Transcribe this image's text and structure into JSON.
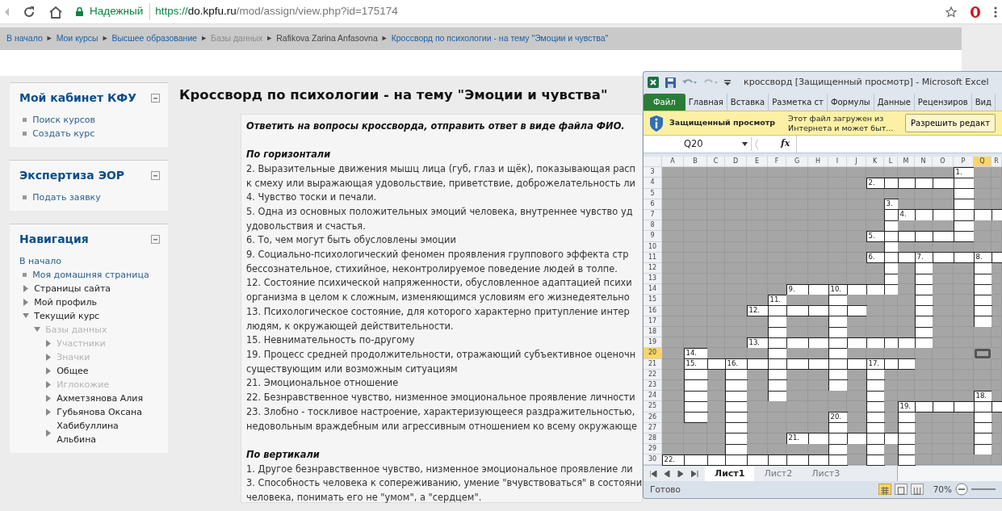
{
  "browser": {
    "security": "Надежный",
    "url_scheme": "https://",
    "url_host": "do.kpfu.ru",
    "url_path": "/mod/assign/view.php?id=175174"
  },
  "breadcrumb": {
    "separator": "►",
    "items": [
      {
        "text": "В начало",
        "kind": "link"
      },
      {
        "text": "Мои курсы",
        "kind": "link"
      },
      {
        "text": "Высшее образование",
        "kind": "link"
      },
      {
        "text": "Базы данных",
        "kind": "dimmed"
      },
      {
        "text": "Rafikova Zarina Anfasovna",
        "kind": "plain"
      },
      {
        "text": "Кроссворд по психологии - на тему \"Эмоции и чувства\"",
        "kind": "link"
      }
    ]
  },
  "sidebar": [
    {
      "title": "Мой кабинет КФУ",
      "items": [
        {
          "kind": "bullet",
          "text": "Поиск курсов"
        },
        {
          "kind": "bullet",
          "text": "Создать курс"
        }
      ]
    },
    {
      "title": "Экспертиза ЭОР",
      "items": [
        {
          "kind": "bullet",
          "text": "Подать заявку"
        }
      ]
    },
    {
      "title": "Навигация",
      "items": [
        {
          "kind": "link",
          "text": "В начало"
        },
        {
          "kind": "bullet",
          "text": "Моя домашняя страница"
        },
        {
          "kind": "node",
          "text": "Страницы сайта",
          "expanded": false,
          "disabled": false
        },
        {
          "kind": "node",
          "text": "Мой профиль",
          "expanded": false,
          "disabled": false
        },
        {
          "kind": "node",
          "text": "Текущий курс",
          "expanded": true,
          "disabled": false,
          "children": [
            {
              "kind": "node",
              "text": "Базы данных",
              "expanded": true,
              "disabled": true,
              "children": [
                {
                  "kind": "node",
                  "text": "Участники",
                  "expanded": false,
                  "disabled": true
                },
                {
                  "kind": "node",
                  "text": "Значки",
                  "expanded": false,
                  "disabled": true
                },
                {
                  "kind": "node",
                  "text": "Общее",
                  "expanded": false,
                  "disabled": false
                },
                {
                  "kind": "node",
                  "text": "Иглокожие",
                  "expanded": false,
                  "disabled": true
                },
                {
                  "kind": "node",
                  "text": "Ахметзянова Алия",
                  "expanded": false,
                  "disabled": false
                },
                {
                  "kind": "node",
                  "text": "Губьянова Оксана",
                  "expanded": false,
                  "disabled": false
                },
                {
                  "kind": "node",
                  "text": "Хабибуллина Альбина",
                  "expanded": false,
                  "disabled": false
                }
              ]
            }
          ]
        }
      ]
    }
  ],
  "page_title": "Кроссворд по психологии - на тему \"Эмоции и чувства\"",
  "assignment": {
    "intro": "Ответить на вопросы кроссворда, отправить ответ в виде файла ФИО.",
    "sections": [
      {
        "heading": "По горизонтали",
        "lines": [
          "2. Выразительные движения мышц лица (губ, глаз и щёк), показывающая расп",
          "к смеху или выражающая удовольствие, приветствие, доброжелательность ли",
          "4. Чувство тоски и печали.",
          "5. Одна из основных положительных эмоций человека, внутреннее чувство уд",
          "удовольствия и счастья.",
          "6. То, чем могут быть обусловлены эмоции",
          "9. Социально-психологический феномен проявления группового эффекта стр",
          "бессознательное, стихийное, неконтролируемое поведение людей в толпе.",
          "12. Состояние психической напряженности, обусловленное адаптацией психи",
          "организма в целом к сложным, изменяющимся условиям его жизнедеятельно",
          "13. Психологическое состояние, для которого характерно притупление интер",
          "людям, к окружающей действительности.",
          "15. Невнимательность по-другому",
          "19. Процесс средней продолжительности, отражающий субъективное оценочн",
          "существующим или возможным ситуациям",
          "21. Эмоциональное отношение",
          "22. Безнравственное чувство, низменное эмоциональное проявление личности",
          "23. Злобно - тоскливое настроение, характеризующееся раздражительностью,",
          "недовольным враждебным или агрессивным отношением ко всему окружающе"
        ]
      },
      {
        "heading": "По вертикали",
        "lines": [
          "1. Другое безнравственное чувство, низменное эмоциональное проявление ли",
          "3. Способность человека к сопереживанию, умение \"вчувствоваться\" в состояни",
          "человека, понимать его не \"умом\", а \"сердцем\"."
        ]
      }
    ]
  },
  "excel": {
    "title": "кроссворд [Защищенный просмотр] - Microsoft Excel",
    "ribbon_tabs": [
      {
        "label": "Файл",
        "kind": "file"
      },
      {
        "label": "Главная",
        "kind": "tab"
      },
      {
        "label": "Вставка",
        "kind": "tab"
      },
      {
        "label": "Разметка ст",
        "kind": "tab"
      },
      {
        "label": "Формулы",
        "kind": "tab"
      },
      {
        "label": "Данные",
        "kind": "tab"
      },
      {
        "label": "Рецензиров",
        "kind": "tab"
      },
      {
        "label": "Вид",
        "kind": "tab"
      }
    ],
    "protected_view": {
      "title": "Защищенный просмотр",
      "message_lines": [
        "Этот файл загружен из",
        "Интернета и может быт..."
      ],
      "button": "Разрешить редакт"
    },
    "name_box": "Q20",
    "function_symbol": "fx",
    "columns": [
      {
        "label": "A",
        "selected": false
      },
      {
        "label": "B",
        "selected": false
      },
      {
        "label": "C",
        "selected": false
      },
      {
        "label": "D",
        "selected": false
      },
      {
        "label": "E",
        "selected": false
      },
      {
        "label": "F",
        "selected": false
      },
      {
        "label": "G",
        "selected": false
      },
      {
        "label": "H",
        "selected": false
      },
      {
        "label": "I",
        "selected": false
      },
      {
        "label": "J",
        "selected": false
      },
      {
        "label": "K",
        "selected": false
      },
      {
        "label": "L",
        "selected": false
      },
      {
        "label": "M",
        "selected": false
      },
      {
        "label": "N",
        "selected": false
      },
      {
        "label": "O",
        "selected": false
      },
      {
        "label": "P",
        "selected": false
      },
      {
        "label": "Q",
        "selected": true
      },
      {
        "label": "R",
        "selected": false
      }
    ],
    "rows": [
      {
        "header": "3",
        "selected": false,
        "cells": [
          false,
          false,
          false,
          false,
          false,
          false,
          false,
          false,
          false,
          false,
          false,
          false,
          false,
          false,
          false,
          "1.",
          false,
          false
        ]
      },
      {
        "header": "4",
        "selected": false,
        "cells": [
          false,
          false,
          false,
          false,
          false,
          false,
          false,
          false,
          false,
          false,
          "2.",
          true,
          true,
          true,
          true,
          true,
          false,
          false
        ]
      },
      {
        "header": "5",
        "selected": false,
        "cells": [
          false,
          false,
          false,
          false,
          false,
          false,
          false,
          false,
          false,
          false,
          false,
          false,
          false,
          false,
          false,
          true,
          false,
          false
        ]
      },
      {
        "header": "6",
        "selected": false,
        "cells": [
          false,
          false,
          false,
          false,
          false,
          false,
          false,
          false,
          false,
          false,
          false,
          "3.",
          false,
          false,
          false,
          true,
          false,
          false
        ]
      },
      {
        "header": "7",
        "selected": false,
        "cells": [
          false,
          false,
          false,
          false,
          false,
          false,
          false,
          false,
          false,
          false,
          false,
          true,
          "4.",
          true,
          true,
          true,
          true,
          true
        ]
      },
      {
        "header": "8",
        "selected": false,
        "cells": [
          false,
          false,
          false,
          false,
          false,
          false,
          false,
          false,
          false,
          false,
          false,
          true,
          false,
          false,
          false,
          true,
          false,
          false
        ]
      },
      {
        "header": "9",
        "selected": false,
        "cells": [
          false,
          false,
          false,
          false,
          false,
          false,
          false,
          false,
          false,
          false,
          "5.",
          true,
          true,
          true,
          true,
          true,
          false,
          false
        ]
      },
      {
        "header": "10",
        "selected": false,
        "cells": [
          false,
          false,
          false,
          false,
          false,
          false,
          false,
          false,
          false,
          false,
          false,
          true,
          false,
          false,
          false,
          false,
          false,
          false
        ]
      },
      {
        "header": "11",
        "selected": false,
        "cells": [
          false,
          false,
          false,
          false,
          false,
          false,
          false,
          false,
          false,
          false,
          "6.",
          true,
          true,
          "7.",
          true,
          true,
          "8.",
          true
        ]
      },
      {
        "header": "12",
        "selected": false,
        "cells": [
          false,
          false,
          false,
          false,
          false,
          false,
          false,
          false,
          false,
          false,
          false,
          true,
          false,
          true,
          false,
          false,
          true,
          false
        ]
      },
      {
        "header": "13",
        "selected": false,
        "cells": [
          false,
          false,
          false,
          false,
          false,
          false,
          false,
          false,
          false,
          false,
          false,
          true,
          false,
          true,
          false,
          false,
          true,
          false
        ]
      },
      {
        "header": "14",
        "selected": false,
        "cells": [
          false,
          false,
          false,
          false,
          false,
          false,
          "9.",
          true,
          "10.",
          true,
          true,
          true,
          false,
          true,
          false,
          false,
          true,
          false
        ]
      },
      {
        "header": "15",
        "selected": false,
        "cells": [
          false,
          false,
          false,
          false,
          false,
          "11.",
          false,
          false,
          true,
          false,
          false,
          false,
          false,
          true,
          false,
          false,
          true,
          false
        ]
      },
      {
        "header": "16",
        "selected": false,
        "cells": [
          false,
          false,
          false,
          false,
          "12.",
          true,
          true,
          true,
          true,
          true,
          false,
          false,
          false,
          true,
          false,
          false,
          true,
          false
        ]
      },
      {
        "header": "17",
        "selected": false,
        "cells": [
          false,
          false,
          false,
          false,
          false,
          true,
          false,
          false,
          true,
          false,
          false,
          false,
          false,
          true,
          false,
          false,
          true,
          false
        ]
      },
      {
        "header": "18",
        "selected": false,
        "cells": [
          false,
          false,
          false,
          false,
          false,
          true,
          false,
          false,
          true,
          false,
          false,
          false,
          false,
          true,
          false,
          false,
          false,
          false
        ]
      },
      {
        "header": "19",
        "selected": false,
        "cells": [
          false,
          false,
          false,
          false,
          "13.",
          true,
          true,
          true,
          true,
          true,
          true,
          true,
          true,
          true,
          false,
          false,
          false,
          false
        ]
      },
      {
        "header": "20",
        "selected": true,
        "cells": [
          false,
          "14.",
          false,
          false,
          false,
          true,
          false,
          false,
          true,
          false,
          false,
          false,
          false,
          false,
          false,
          false,
          false,
          false
        ]
      },
      {
        "header": "21",
        "selected": false,
        "cells": [
          false,
          "15.",
          true,
          "16.",
          true,
          true,
          true,
          true,
          true,
          true,
          "17.",
          true,
          true,
          false,
          false,
          false,
          false,
          false
        ]
      },
      {
        "header": "22",
        "selected": false,
        "cells": [
          false,
          true,
          false,
          true,
          false,
          true,
          false,
          false,
          true,
          false,
          true,
          false,
          false,
          false,
          false,
          false,
          false,
          false
        ]
      },
      {
        "header": "23",
        "selected": false,
        "cells": [
          false,
          true,
          false,
          true,
          false,
          true,
          false,
          false,
          true,
          false,
          true,
          false,
          false,
          false,
          false,
          false,
          false,
          false
        ]
      },
      {
        "header": "24",
        "selected": false,
        "cells": [
          false,
          true,
          false,
          true,
          false,
          true,
          false,
          false,
          false,
          false,
          true,
          false,
          false,
          false,
          false,
          false,
          "18.",
          false
        ]
      },
      {
        "header": "25",
        "selected": false,
        "cells": [
          false,
          true,
          false,
          true,
          false,
          false,
          false,
          false,
          false,
          false,
          true,
          false,
          "19.",
          true,
          true,
          true,
          true,
          true
        ]
      },
      {
        "header": "26",
        "selected": false,
        "cells": [
          false,
          true,
          false,
          true,
          false,
          false,
          false,
          false,
          "20.",
          false,
          true,
          false,
          true,
          false,
          false,
          false,
          true,
          false
        ]
      },
      {
        "header": "27",
        "selected": false,
        "cells": [
          false,
          false,
          false,
          true,
          false,
          false,
          false,
          false,
          true,
          false,
          true,
          false,
          true,
          false,
          false,
          false,
          true,
          false
        ]
      },
      {
        "header": "28",
        "selected": false,
        "cells": [
          false,
          false,
          false,
          true,
          false,
          false,
          "21.",
          true,
          true,
          true,
          true,
          true,
          true,
          false,
          false,
          false,
          true,
          false
        ]
      },
      {
        "header": "29",
        "selected": false,
        "cells": [
          false,
          false,
          false,
          true,
          false,
          false,
          false,
          false,
          true,
          false,
          true,
          false,
          true,
          false,
          false,
          false,
          true,
          false
        ]
      },
      {
        "header": "30",
        "selected": false,
        "cells": [
          "22.",
          true,
          true,
          true,
          true,
          true,
          true,
          true,
          true,
          false,
          true,
          false,
          true,
          false,
          false,
          false,
          false,
          false
        ]
      }
    ],
    "sheet_tabs": [
      {
        "label": "Лист1",
        "selected": true
      },
      {
        "label": "Лист2",
        "selected": false
      },
      {
        "label": "Лист3",
        "selected": false
      }
    ],
    "status": "Готово",
    "views": [
      {
        "kind": "normal",
        "selected": true
      },
      {
        "kind": "page_layout",
        "selected": false
      },
      {
        "kind": "page_break",
        "selected": false
      }
    ],
    "zoom_label": "70%"
  }
}
